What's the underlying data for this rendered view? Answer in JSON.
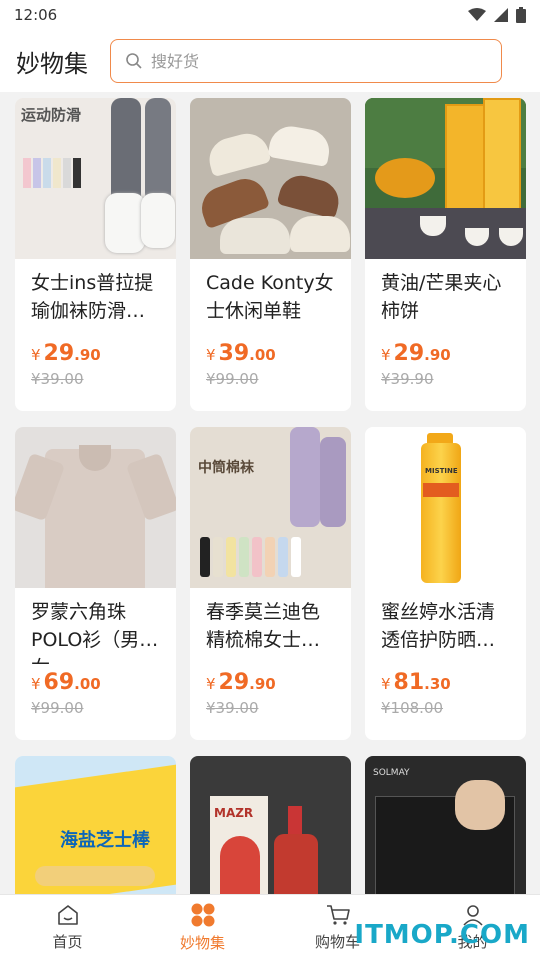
{
  "status": {
    "time": "12:06"
  },
  "header": {
    "title": "妙物集",
    "search_placeholder": "搜好货"
  },
  "products": [
    {
      "title": "女士ins普拉提瑜伽袜防滑…",
      "price_int": "29",
      "price_dec": ".90",
      "orig": "¥39.00",
      "img_text": "运动防滑"
    },
    {
      "title": "Cade Konty女士休闲单鞋",
      "price_int": "39",
      "price_dec": ".00",
      "orig": "¥99.00",
      "img_text": ""
    },
    {
      "title": "黄油/芒果夹心柿饼",
      "price_int": "29",
      "price_dec": ".90",
      "orig": "¥39.90",
      "img_text": ""
    },
    {
      "title": "罗蒙六角珠POLO衫（男女…",
      "price_int": "69",
      "price_dec": ".00",
      "orig": "¥99.00",
      "img_text": ""
    },
    {
      "title": "春季莫兰迪色精梳棉女士…",
      "price_int": "29",
      "price_dec": ".90",
      "orig": "¥39.00",
      "img_text": "中筒棉袜"
    },
    {
      "title": "蜜丝婷水活清透倍护防晒…",
      "price_int": "81",
      "price_dec": ".30",
      "orig": "¥108.00",
      "img_text": "MISTINE"
    },
    {
      "img_text": "海盐芝士棒"
    },
    {
      "img_text": "MAZR"
    },
    {
      "img_text": "SOLMAY"
    }
  ],
  "price_symbol": "¥",
  "tabs": [
    {
      "label": "首页",
      "icon": "home-icon",
      "active": false
    },
    {
      "label": "妙物集",
      "icon": "grid-icon",
      "active": true
    },
    {
      "label": "购物车",
      "icon": "cart-icon",
      "active": false
    },
    {
      "label": "我的",
      "icon": "user-icon",
      "active": false
    }
  ],
  "watermark": "ITMOP.COM",
  "colors": {
    "accent": "#f07a2e",
    "price": "#f06a25"
  }
}
